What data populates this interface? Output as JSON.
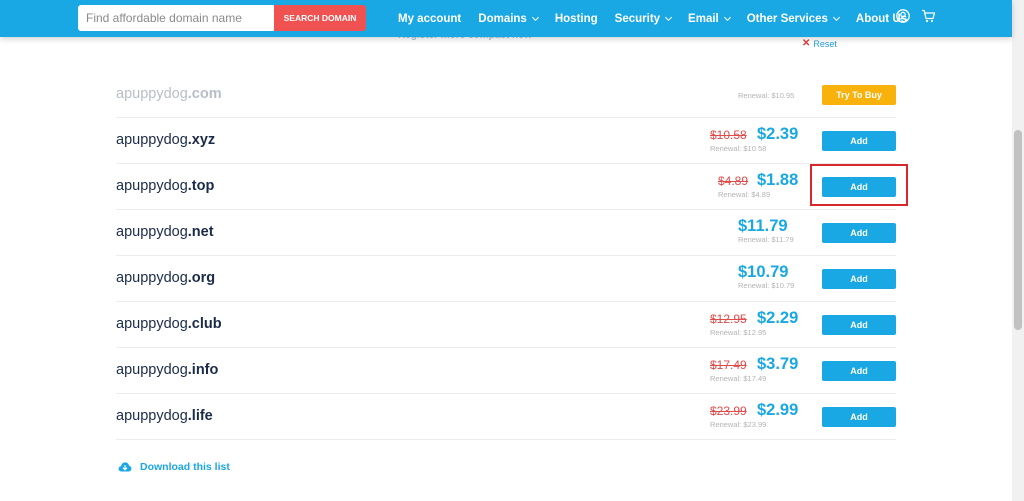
{
  "header": {
    "search_placeholder": "Find affordable domain name",
    "search_button": "SEARCH DOMAIN",
    "nav": [
      {
        "label": "My account",
        "dropdown": false
      },
      {
        "label": "Domains",
        "dropdown": true
      },
      {
        "label": "Hosting",
        "dropdown": false
      },
      {
        "label": "Security",
        "dropdown": true
      },
      {
        "label": "Email",
        "dropdown": true
      },
      {
        "label": "Other Services",
        "dropdown": true
      },
      {
        "label": "About Us",
        "dropdown": false
      }
    ],
    "icons": [
      "user-icon",
      "cart-icon"
    ]
  },
  "filter_bar": {
    "partial_text": "Register more compact now",
    "reset_label": "Reset"
  },
  "results": [
    {
      "name": "apuppydog",
      "tld": ".com",
      "available": false,
      "old_price": "",
      "price": "",
      "renewal": "Renewal: $10.95",
      "button": "Try To Buy"
    },
    {
      "name": "apuppydog",
      "tld": ".xyz",
      "available": true,
      "old_price": "$10.58",
      "price": "$2.39",
      "renewal": "Renewal: $10.58",
      "button": "Add"
    },
    {
      "name": "apuppydog",
      "tld": ".top",
      "available": true,
      "old_price": "$4.89",
      "price": "$1.88",
      "renewal": "Renewal: $4.89",
      "button": "Add"
    },
    {
      "name": "apuppydog",
      "tld": ".net",
      "available": true,
      "old_price": "",
      "price": "$11.79",
      "renewal": "Renewal: $11.79",
      "button": "Add"
    },
    {
      "name": "apuppydog",
      "tld": ".org",
      "available": true,
      "old_price": "",
      "price": "$10.79",
      "renewal": "Renewal: $10.79",
      "button": "Add"
    },
    {
      "name": "apuppydog",
      "tld": ".club",
      "available": true,
      "old_price": "$12.95",
      "price": "$2.29",
      "renewal": "Renewal: $12.95",
      "button": "Add"
    },
    {
      "name": "apuppydog",
      "tld": ".info",
      "available": true,
      "old_price": "$17.49",
      "price": "$3.79",
      "renewal": "Renewal: $17.49",
      "button": "Add"
    },
    {
      "name": "apuppydog",
      "tld": ".life",
      "available": true,
      "old_price": "$23.99",
      "price": "$2.99",
      "renewal": "Renewal: $23.99",
      "button": "Add"
    }
  ],
  "download_label": "Download this list",
  "colors": {
    "brand_blue": "#1aa8e4",
    "search_red": "#f05151",
    "strike_red": "#e34a4a",
    "try_yellow": "#f9b10b",
    "highlight_red": "#d9272e"
  }
}
